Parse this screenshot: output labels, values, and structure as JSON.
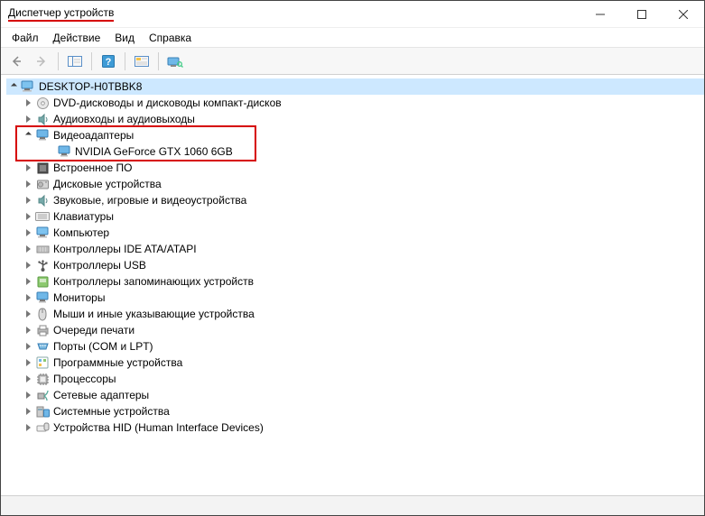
{
  "window": {
    "title": "Диспетчер устройств"
  },
  "menu": {
    "file": "Файл",
    "action": "Действие",
    "view": "Вид",
    "help": "Справка"
  },
  "tree": {
    "root": "DESKTOP-H0TBBK8",
    "items": [
      {
        "icon": "disc",
        "label": "DVD-дисководы и дисководы компакт-дисков",
        "expanded": false
      },
      {
        "icon": "audio",
        "label": "Аудиовходы и аудиовыходы",
        "expanded": false
      },
      {
        "icon": "monitor",
        "label": "Видеоадаптеры",
        "expanded": true,
        "children": [
          {
            "icon": "monitor",
            "label": "NVIDIA GeForce GTX 1060 6GB"
          }
        ]
      },
      {
        "icon": "firmware",
        "label": "Встроенное ПО",
        "expanded": false
      },
      {
        "icon": "drive",
        "label": "Дисковые устройства",
        "expanded": false
      },
      {
        "icon": "audio",
        "label": "Звуковые, игровые и видеоустройства",
        "expanded": false
      },
      {
        "icon": "keyboard",
        "label": "Клавиатуры",
        "expanded": false
      },
      {
        "icon": "computer",
        "label": "Компьютер",
        "expanded": false
      },
      {
        "icon": "ide",
        "label": "Контроллеры IDE ATA/ATAPI",
        "expanded": false
      },
      {
        "icon": "usb",
        "label": "Контроллеры USB",
        "expanded": false
      },
      {
        "icon": "storage",
        "label": "Контроллеры запоминающих устройств",
        "expanded": false
      },
      {
        "icon": "monitor",
        "label": "Мониторы",
        "expanded": false
      },
      {
        "icon": "mouse",
        "label": "Мыши и иные указывающие устройства",
        "expanded": false
      },
      {
        "icon": "printer",
        "label": "Очереди печати",
        "expanded": false
      },
      {
        "icon": "port",
        "label": "Порты (COM и LPT)",
        "expanded": false
      },
      {
        "icon": "software",
        "label": "Программные устройства",
        "expanded": false
      },
      {
        "icon": "cpu",
        "label": "Процессоры",
        "expanded": false
      },
      {
        "icon": "network",
        "label": "Сетевые адаптеры",
        "expanded": false
      },
      {
        "icon": "system",
        "label": "Системные устройства",
        "expanded": false
      },
      {
        "icon": "hid",
        "label": "Устройства HID (Human Interface Devices)",
        "expanded": false
      }
    ]
  }
}
